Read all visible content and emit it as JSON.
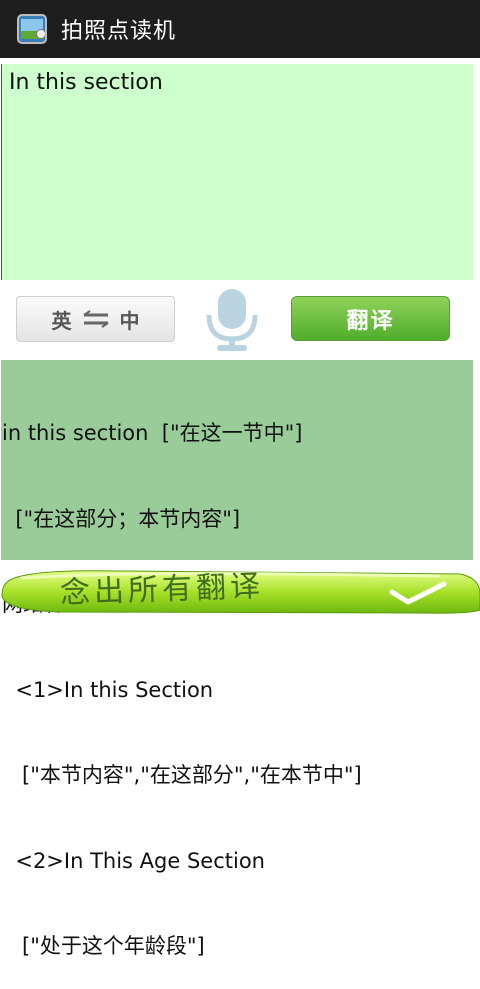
{
  "app": {
    "title": "拍照点读机",
    "icon": "app-gallery-icon"
  },
  "input": {
    "text": "In this section"
  },
  "controls": {
    "lang_from": "英",
    "lang_to": "中",
    "swap_icon": "swap-arrows-icon",
    "mic_icon": "microphone-icon",
    "translate_label": "翻译"
  },
  "result": {
    "lines": [
      "in this section  [\"在这一节中\"]",
      "  [\"在这部分；本节内容\"]",
      "网络释义：",
      "  <1>In this Section",
      "   [\"本节内容\",\"在这部分\",\"在本节中\"]",
      "  <2>In This Age Section",
      "   [\"处于这个年龄段\"]"
    ]
  },
  "read_all": {
    "label": "念出所有翻译",
    "icon": "checkmark-icon"
  },
  "colors": {
    "titlebar": "#1e1e1e",
    "input_bg": "#ccffcc",
    "result_bg": "#99cc99",
    "accent_green": "#4fae2b"
  }
}
